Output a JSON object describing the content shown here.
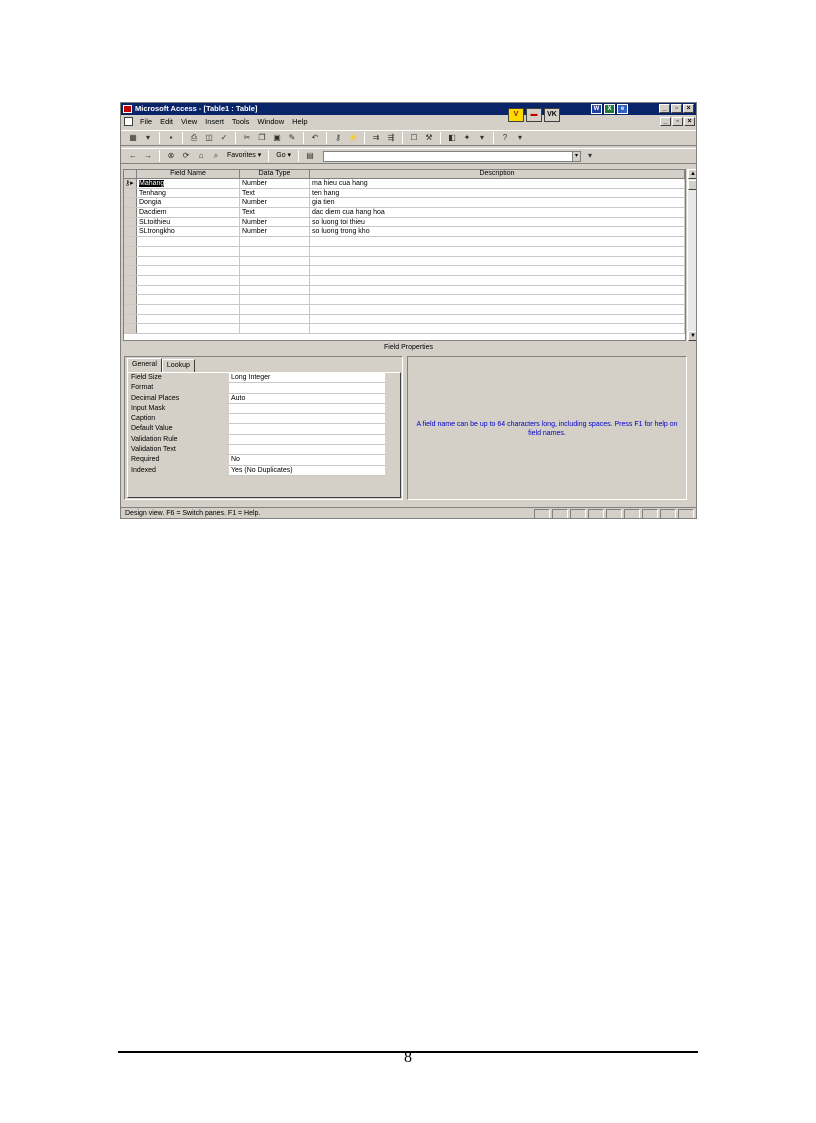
{
  "window": {
    "title": "Microsoft Access - [Table1 : Table]",
    "floating_toolbar": [
      "V",
      "VK"
    ],
    "tray_icons": [
      "W",
      "X"
    ]
  },
  "menubar": {
    "items": [
      "File",
      "Edit",
      "View",
      "Insert",
      "Tools",
      "Window",
      "Help"
    ]
  },
  "toolbar2": {
    "favorites_label": "Favorites ▾",
    "go_label": "Go ▾",
    "address_value": ""
  },
  "design_grid": {
    "columns": [
      "Field Name",
      "Data Type",
      "Description"
    ],
    "rows": [
      {
        "name": "Mahang",
        "type": "Number",
        "desc": "ma hieu cua hang"
      },
      {
        "name": "Tenhang",
        "type": "Text",
        "desc": "ten hang"
      },
      {
        "name": "Dongia",
        "type": "Number",
        "desc": "gia tien"
      },
      {
        "name": "Dacdiem",
        "type": "Text",
        "desc": "dac diem cua hang hoa"
      },
      {
        "name": "SLtoithieu",
        "type": "Number",
        "desc": "so luong toi thieu"
      },
      {
        "name": "SLtrongkho",
        "type": "Number",
        "desc": "so luong trong kho"
      }
    ],
    "empty_rows": 10
  },
  "field_properties": {
    "title": "Field Properties",
    "tabs": [
      "General",
      "Lookup"
    ],
    "rows": [
      {
        "label": "Field Size",
        "value": "Long Integer"
      },
      {
        "label": "Format",
        "value": ""
      },
      {
        "label": "Decimal Places",
        "value": "Auto"
      },
      {
        "label": "Input Mask",
        "value": ""
      },
      {
        "label": "Caption",
        "value": ""
      },
      {
        "label": "Default Value",
        "value": ""
      },
      {
        "label": "Validation Rule",
        "value": ""
      },
      {
        "label": "Validation Text",
        "value": ""
      },
      {
        "label": "Required",
        "value": "No"
      },
      {
        "label": "Indexed",
        "value": "Yes (No Duplicates)"
      }
    ],
    "help_text": "A field name can be up to 64 characters long, including spaces.  Press F1 for help on field names."
  },
  "statusbar": {
    "text": "Design view.  F6 = Switch panes.  F1 = Help."
  },
  "page": {
    "number": "8"
  }
}
